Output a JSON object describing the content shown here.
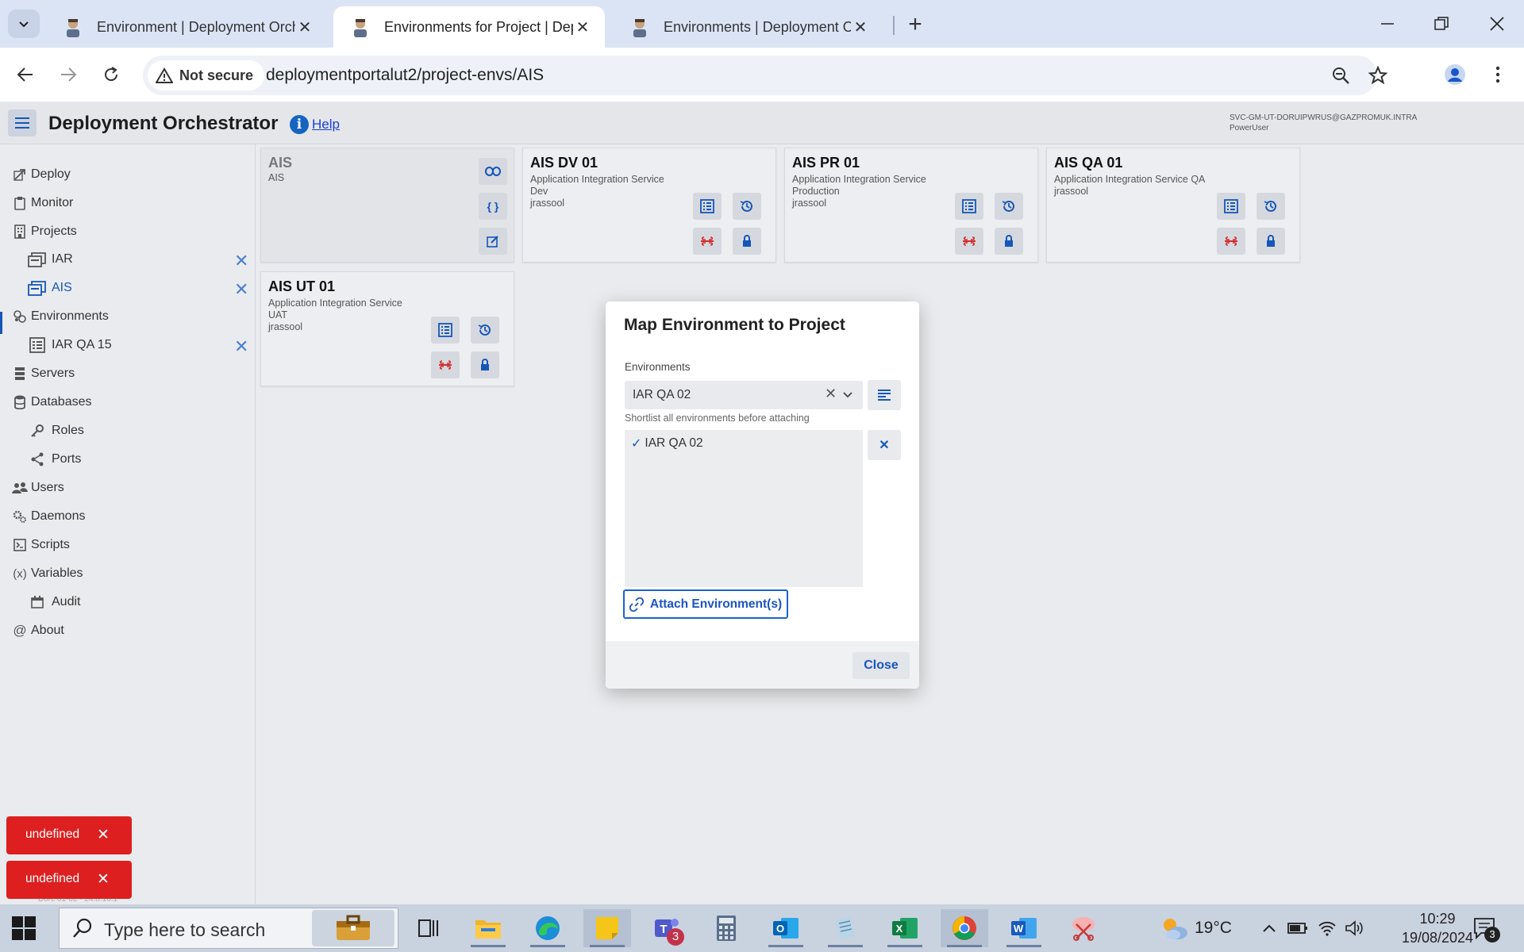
{
  "browser": {
    "tabs": [
      {
        "title": "Environment | Deployment Orchestrator"
      },
      {
        "title": "Environments for Project | Deployment Orchestrator"
      },
      {
        "title": "Environments | Deployment Orchestrator"
      }
    ],
    "not_secure_label": "Not secure",
    "url": "deploymentportalut2/project-envs/AIS"
  },
  "app": {
    "title": "Deployment Orchestrator",
    "help_label": "Help",
    "user_account": "SVC-GM-UT-DORUIPWRUS@GAZPROMUK.INTRA",
    "user_role": "PowerUser",
    "version": "Dorc 01-02 - 24.8.16.1"
  },
  "sidebar": {
    "items": [
      {
        "label": "Deploy",
        "icon": "deploy-icon"
      },
      {
        "label": "Monitor",
        "icon": "clipboard-icon"
      },
      {
        "label": "Projects",
        "icon": "building-icon"
      },
      {
        "label": "IAR",
        "icon": "project-icon"
      },
      {
        "label": "AIS",
        "icon": "project-icon"
      },
      {
        "label": "Environments",
        "icon": "environments-icon"
      },
      {
        "label": "IAR QA 15",
        "icon": "environment-icon"
      },
      {
        "label": "Servers",
        "icon": "server-icon"
      },
      {
        "label": "Databases",
        "icon": "database-icon"
      },
      {
        "label": "Roles",
        "icon": "key-icon"
      },
      {
        "label": "Ports",
        "icon": "share-icon"
      },
      {
        "label": "Users",
        "icon": "users-icon"
      },
      {
        "label": "Daemons",
        "icon": "gears-icon"
      },
      {
        "label": "Scripts",
        "icon": "script-icon"
      },
      {
        "label": "Variables",
        "icon": "variables-icon"
      },
      {
        "label": "Audit",
        "icon": "calendar-icon"
      },
      {
        "label": "About",
        "icon": "at-icon"
      }
    ]
  },
  "cards": [
    {
      "name": "AIS",
      "line1": "AIS"
    },
    {
      "name": "AIS DV 01",
      "line1": "Application Integration Service",
      "line2": "Dev",
      "line3": "jrassool"
    },
    {
      "name": "AIS PR 01",
      "line1": "Application Integration Service",
      "line2": "Production",
      "line3": "jrassool"
    },
    {
      "name": "AIS QA 01",
      "line1": "Application Integration Service QA",
      "line2": "jrassool"
    },
    {
      "name": "AIS UT 01",
      "line1": "Application Integration Service",
      "line2": "UAT",
      "line3": "jrassool"
    }
  ],
  "dialog": {
    "title": "Map Environment to Project",
    "environments_label": "Environments",
    "selected_value": "IAR QA 02",
    "hint": "Shortlist all environments before attaching",
    "shortlist": [
      "IAR QA 02"
    ],
    "attach_label": "Attach Environment(s)",
    "close_label": "Close"
  },
  "toasts": [
    "undefined",
    "undefined"
  ],
  "taskbar": {
    "search_placeholder": "Type here to search",
    "teams_badge": "3",
    "temperature": "19°C",
    "time": "10:29",
    "date": "19/08/2024",
    "notification_count": "3"
  },
  "colors": {
    "accent": "#1656b8",
    "danger": "#dd1f1f",
    "tabstrip": "#dbe4f5"
  }
}
